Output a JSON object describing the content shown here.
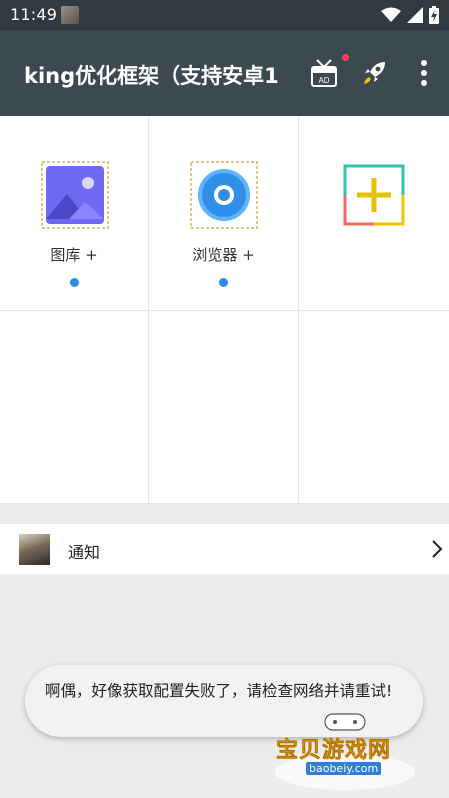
{
  "status_bar": {
    "time": "11:49",
    "icons": [
      "avatar-thumbnail",
      "wifi-icon",
      "signal-icon",
      "battery-charging-icon"
    ]
  },
  "app_bar": {
    "title": "king优化框架（支持安卓1",
    "actions": [
      "ad-icon",
      "rocket-icon",
      "more-vert-icon"
    ],
    "badge_color": "#ff3d5a",
    "background": "#3d4950"
  },
  "grid": {
    "items": [
      {
        "label": "图库 +",
        "icon": "gallery-icon",
        "has_dot": true
      },
      {
        "label": "浏览器 +",
        "icon": "browser-icon",
        "has_dot": true
      },
      {
        "label": "",
        "icon": "add-plus-icon",
        "has_dot": false
      }
    ],
    "dot_color": "#2f8be6"
  },
  "notice": {
    "label": "通知",
    "icon": "chevron-right-icon"
  },
  "toast": {
    "message": "啊偶，好像获取配置失败了，请检查网络并请重试!"
  },
  "watermark": {
    "name": "宝贝游戏网",
    "url": "baobeiy.com"
  }
}
